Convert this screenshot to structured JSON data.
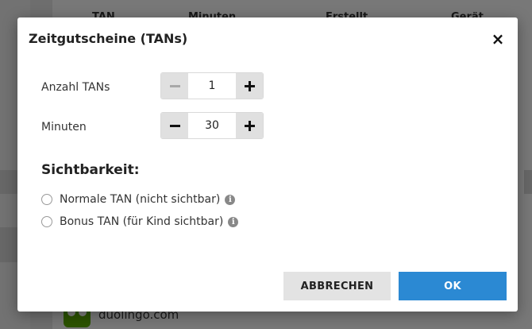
{
  "background": {
    "table_headers": [
      "TAN",
      "Minuten",
      "Erstellt",
      "Gerät"
    ],
    "footer_item": "duolingo.com"
  },
  "dialog": {
    "title": "Zeitgutscheine (TANs)",
    "count_label": "Anzahl TANs",
    "count_value": "1",
    "minutes_label": "Minuten",
    "minutes_value": "30",
    "visibility_heading": "Sichtbarkeit:",
    "options": [
      {
        "label": "Normale TAN (nicht sichtbar)"
      },
      {
        "label": "Bonus TAN (für Kind sichtbar)"
      }
    ],
    "cancel_label": "ABBRECHEN",
    "ok_label": "OK"
  },
  "colors": {
    "primary": "#2b89d3",
    "secondary_button": "#e3e3e3",
    "stepper_button": "#e0e0e0"
  },
  "icons": [
    "close-icon",
    "minus-icon",
    "plus-icon",
    "info-icon",
    "app-icon"
  ]
}
